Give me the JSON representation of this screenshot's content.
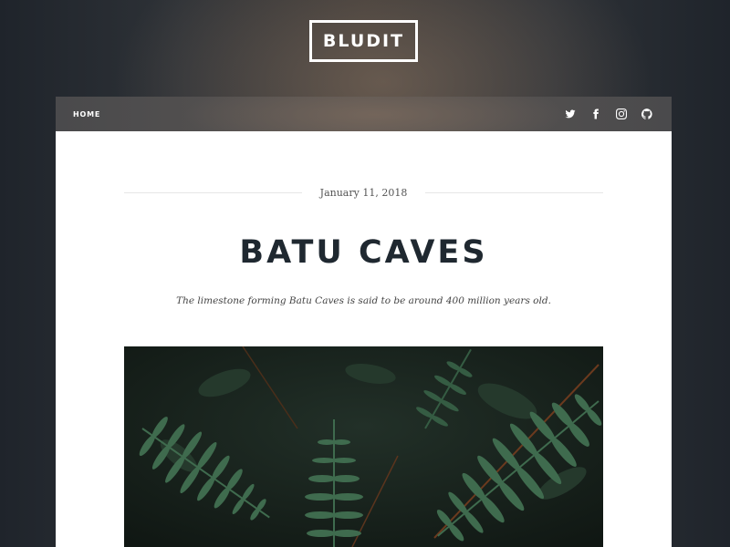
{
  "site": {
    "logo_text": "BLUDIT"
  },
  "nav": {
    "home_label": "HOME",
    "social_icons": [
      "twitter-icon",
      "facebook-icon",
      "instagram-icon",
      "github-icon"
    ]
  },
  "post": {
    "date": "January 11, 2018",
    "title": "BATU CAVES",
    "description": "The limestone forming Batu Caves is said to be around 400 million years old."
  },
  "colors": {
    "title": "#1f2830",
    "card": "#ffffff",
    "nav_text": "#ffffff",
    "fern": "#3f6b4e"
  }
}
